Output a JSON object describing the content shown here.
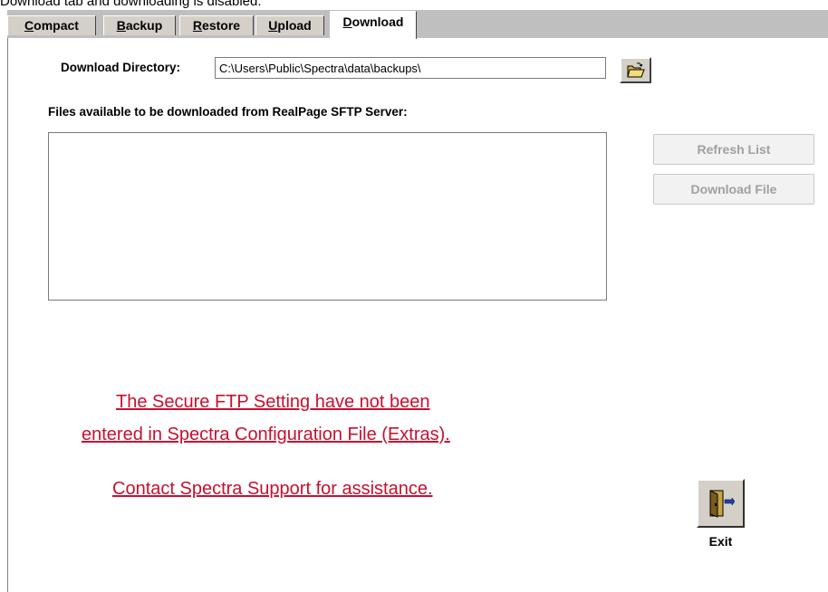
{
  "caption": "Download tab and downloading is disabled.",
  "tabs": [
    {
      "label": "Compact",
      "accel": "C",
      "rest": "ompact"
    },
    {
      "label": "Backup",
      "accel": "B",
      "rest": "ackup"
    },
    {
      "label": "Restore",
      "accel": "R",
      "rest": "estore"
    },
    {
      "label": "Upload",
      "accel": "U",
      "rest": "pload"
    },
    {
      "label": "Download",
      "accel": "D",
      "rest": "ownload"
    }
  ],
  "download": {
    "directory_label": "Download Directory:",
    "directory_value": "C:\\Users\\Public\\Spectra\\data\\backups\\",
    "files_label": "Files available to be downloaded from RealPage SFTP Server:",
    "refresh_label": "Refresh List",
    "download_label": "Download File",
    "warning_line1": "The Secure FTP Setting have not been",
    "warning_line2": "entered in Spectra Configuration File (Extras).",
    "warning_line3": "Contact Spectra Support for assistance.",
    "exit_label": "Exit"
  },
  "icons": {
    "browse": "open-folder-icon",
    "exit": "exit-door-icon"
  },
  "colors": {
    "warning": "#c8102e",
    "disabled_text": "#a0a0a0"
  }
}
